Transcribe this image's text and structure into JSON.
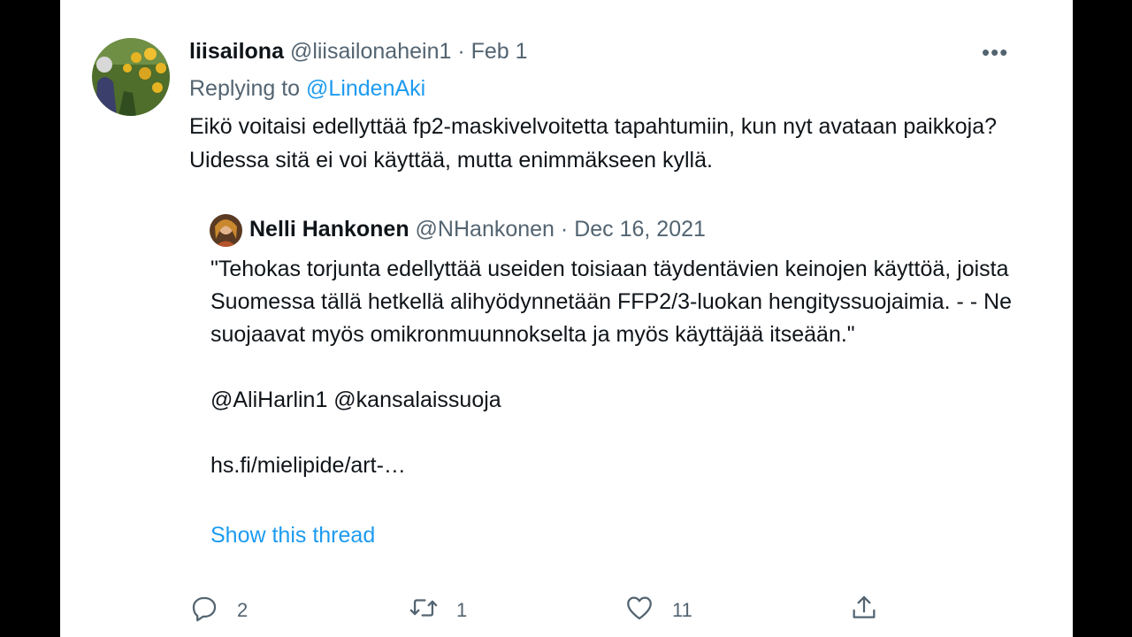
{
  "tweet": {
    "display_name": "liisailona",
    "handle": "@liisailonahein1",
    "separator": "·",
    "date": "Feb 1",
    "replying_prefix": "Replying to",
    "replying_to": "@LindenAki",
    "text": "Eikö voitaisi edellyttää fp2-maskivelvoitetta tapahtumiin, kun nyt avataan paikkoja? Uidessa sitä ei voi käyttää, mutta enimmäkseen kyllä.",
    "more_label": "•••"
  },
  "quoted": {
    "display_name": "Nelli Hankonen",
    "handle": "@NHankonen",
    "separator": "·",
    "date": "Dec 16, 2021",
    "text": "\"Tehokas torjunta edellyttää useiden toisiaan täydentävien keinojen käyttöä, joista Suomessa tällä hetkellä alihyödynnetään FFP2/3-luokan hengityssuojaimia. - - Ne suojaavat myös omikronmuunnokselta ja myös käyttäjää itseään.\"\n\n@AliHarlin1 @kansalaissuoja\n\nhs.fi/mielipide/art-…",
    "show_thread": "Show this thread"
  },
  "actions": {
    "reply_icon": "reply-icon",
    "reply_count": "2",
    "retweet_icon": "retweet-icon",
    "retweet_count": "1",
    "like_icon": "heart-icon",
    "like_count": "11",
    "share_icon": "share-icon"
  },
  "colors": {
    "link": "#1d9bf0",
    "text": "#0f1419",
    "muted": "#536471"
  }
}
